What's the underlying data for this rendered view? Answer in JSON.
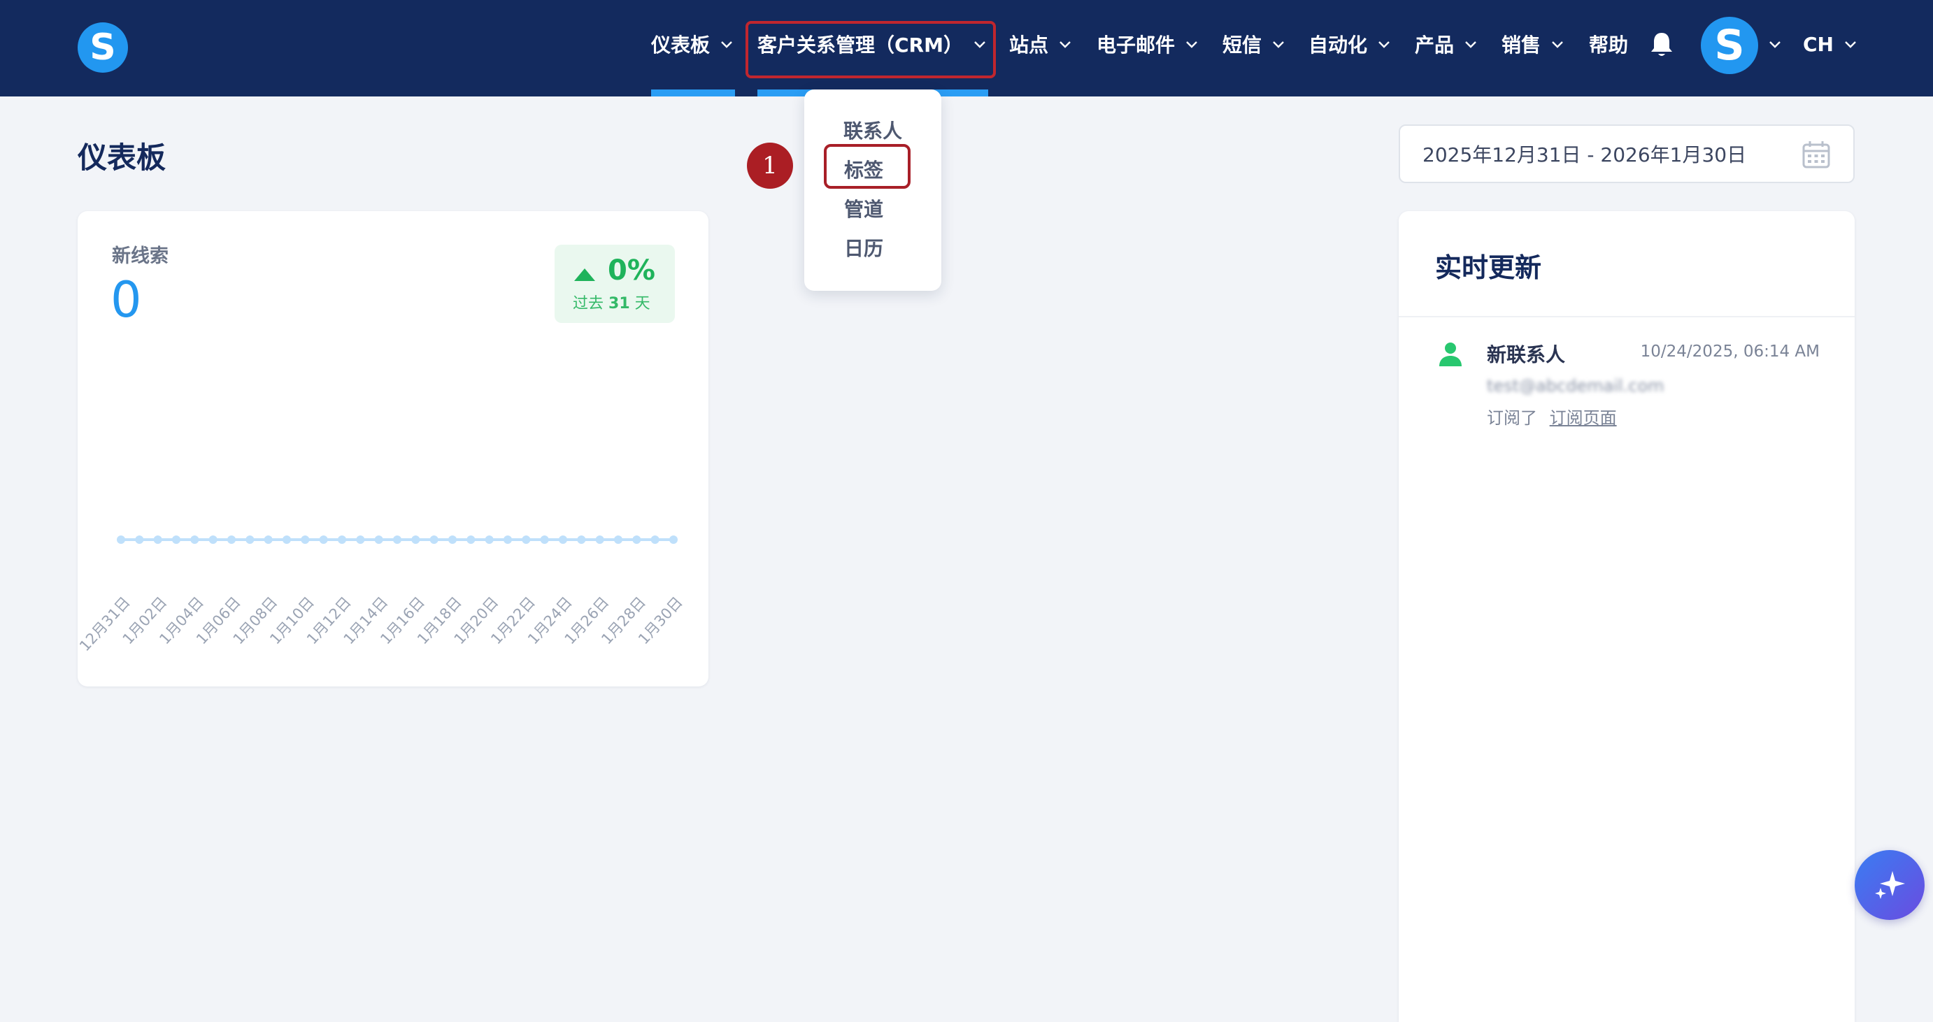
{
  "nav": {
    "logo_letter": "S",
    "items": [
      {
        "label": "仪表板",
        "has_chevron": true
      },
      {
        "label": "客户关系管理（CRM）",
        "has_chevron": true
      },
      {
        "label": "站点",
        "has_chevron": true
      },
      {
        "label": "电子邮件",
        "has_chevron": true
      },
      {
        "label": "短信",
        "has_chevron": true
      },
      {
        "label": "自动化",
        "has_chevron": true
      },
      {
        "label": "产品",
        "has_chevron": true
      },
      {
        "label": "销售",
        "has_chevron": true
      },
      {
        "label": "帮助",
        "has_chevron": false
      }
    ],
    "avatar_letter": "S",
    "language": "CH"
  },
  "crm_menu": {
    "items": [
      "联系人",
      "标签",
      "管道",
      "日历"
    ],
    "highlighted": "标签"
  },
  "step_badge": "1",
  "page": {
    "title": "仪表板",
    "date_range": "2025年12月31日 - 2026年1月30日"
  },
  "leads_card": {
    "label": "新线索",
    "value": "0",
    "trend_pct": "0%",
    "trend_prefix": "过去",
    "trend_days": "31",
    "trend_suffix": "天"
  },
  "chart_data": {
    "type": "line",
    "title": "",
    "xlabel": "",
    "ylabel": "",
    "categories": [
      "12月31日",
      "1月02日",
      "1月04日",
      "1月06日",
      "1月08日",
      "1月10日",
      "1月12日",
      "1月14日",
      "1月16日",
      "1月18日",
      "1月20日",
      "1月22日",
      "1月24日",
      "1月26日",
      "1月28日",
      "1月30日"
    ],
    "x": [
      "12月31日",
      "1月01日",
      "1月02日",
      "1月03日",
      "1月04日",
      "1月05日",
      "1月06日",
      "1月07日",
      "1月08日",
      "1月09日",
      "1月10日",
      "1月11日",
      "1月12日",
      "1月13日",
      "1月14日",
      "1月15日",
      "1月16日",
      "1月17日",
      "1月18日",
      "1月19日",
      "1月20日",
      "1月21日",
      "1月22日",
      "1月23日",
      "1月24日",
      "1月25日",
      "1月26日",
      "1月27日",
      "1月28日",
      "1月29日",
      "1月30日"
    ],
    "values": [
      0,
      0,
      0,
      0,
      0,
      0,
      0,
      0,
      0,
      0,
      0,
      0,
      0,
      0,
      0,
      0,
      0,
      0,
      0,
      0,
      0,
      0,
      0,
      0,
      0,
      0,
      0,
      0,
      0,
      0,
      0
    ],
    "grid": false,
    "color": "#bfe0fb"
  },
  "realtime": {
    "title": "实时更新",
    "events": [
      {
        "type": "新联系人",
        "time": "10/24/2025, 06:14 AM",
        "email": "test@abcdemail.com",
        "desc_prefix": "订阅了",
        "desc_link": "订阅页面"
      }
    ]
  },
  "colors": {
    "nav_bg": "#132a5e",
    "accent": "#2497ef",
    "success": "#1fb35b",
    "highlight": "#c0262e"
  }
}
